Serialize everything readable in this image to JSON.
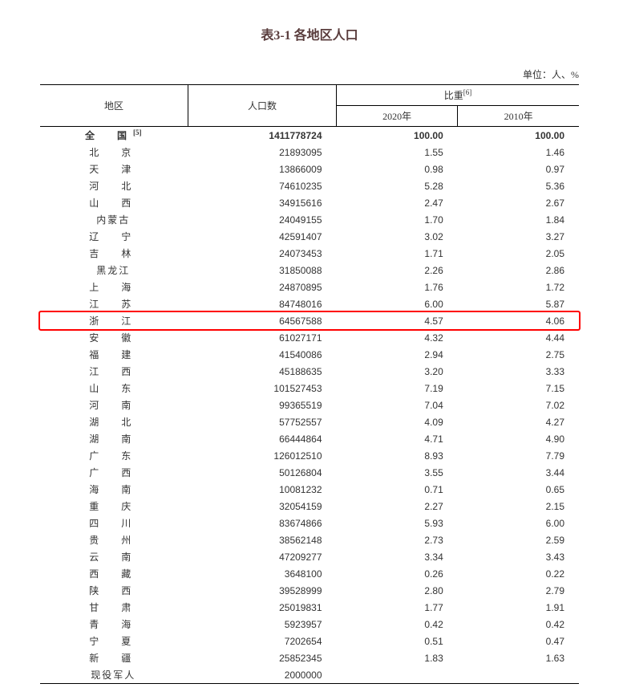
{
  "title": "表3-1 各地区人口",
  "unit": "单位：人、%",
  "headers": {
    "region": "地区",
    "population": "人口数",
    "ratio": "比重",
    "ratio_sup": "[6]",
    "year2020": "2020年",
    "year2010": "2010年"
  },
  "total_row": {
    "region": "全　国",
    "region_sup": "[5]",
    "population": "1411778724",
    "ratio2020": "100.00",
    "ratio2010": "100.00"
  },
  "rows": [
    {
      "region": "北　京",
      "population": "21893095",
      "r2020": "1.55",
      "r2010": "1.46",
      "tight": false
    },
    {
      "region": "天　津",
      "population": "13866009",
      "r2020": "0.98",
      "r2010": "0.97",
      "tight": false
    },
    {
      "region": "河　北",
      "population": "74610235",
      "r2020": "5.28",
      "r2010": "5.36",
      "tight": false
    },
    {
      "region": "山　西",
      "population": "34915616",
      "r2020": "2.47",
      "r2010": "2.67",
      "tight": false
    },
    {
      "region": "内蒙古",
      "population": "24049155",
      "r2020": "1.70",
      "r2010": "1.84",
      "tight": true
    },
    {
      "region": "辽　宁",
      "population": "42591407",
      "r2020": "3.02",
      "r2010": "3.27",
      "tight": false
    },
    {
      "region": "吉　林",
      "population": "24073453",
      "r2020": "1.71",
      "r2010": "2.05",
      "tight": false
    },
    {
      "region": "黑龙江",
      "population": "31850088",
      "r2020": "2.26",
      "r2010": "2.86",
      "tight": true
    },
    {
      "region": "上　海",
      "population": "24870895",
      "r2020": "1.76",
      "r2010": "1.72",
      "tight": false
    },
    {
      "region": "江　苏",
      "population": "84748016",
      "r2020": "6.00",
      "r2010": "5.87",
      "tight": false
    },
    {
      "region": "浙　江",
      "population": "64567588",
      "r2020": "4.57",
      "r2010": "4.06",
      "tight": false,
      "highlight": true
    },
    {
      "region": "安　徽",
      "population": "61027171",
      "r2020": "4.32",
      "r2010": "4.44",
      "tight": false
    },
    {
      "region": "福　建",
      "population": "41540086",
      "r2020": "2.94",
      "r2010": "2.75",
      "tight": false
    },
    {
      "region": "江　西",
      "population": "45188635",
      "r2020": "3.20",
      "r2010": "3.33",
      "tight": false
    },
    {
      "region": "山　东",
      "population": "101527453",
      "r2020": "7.19",
      "r2010": "7.15",
      "tight": false
    },
    {
      "region": "河　南",
      "population": "99365519",
      "r2020": "7.04",
      "r2010": "7.02",
      "tight": false
    },
    {
      "region": "湖　北",
      "population": "57752557",
      "r2020": "4.09",
      "r2010": "4.27",
      "tight": false
    },
    {
      "region": "湖　南",
      "population": "66444864",
      "r2020": "4.71",
      "r2010": "4.90",
      "tight": false
    },
    {
      "region": "广　东",
      "population": "126012510",
      "r2020": "8.93",
      "r2010": "7.79",
      "tight": false
    },
    {
      "region": "广　西",
      "population": "50126804",
      "r2020": "3.55",
      "r2010": "3.44",
      "tight": false
    },
    {
      "region": "海　南",
      "population": "10081232",
      "r2020": "0.71",
      "r2010": "0.65",
      "tight": false
    },
    {
      "region": "重　庆",
      "population": "32054159",
      "r2020": "2.27",
      "r2010": "2.15",
      "tight": false
    },
    {
      "region": "四　川",
      "population": "83674866",
      "r2020": "5.93",
      "r2010": "6.00",
      "tight": false
    },
    {
      "region": "贵　州",
      "population": "38562148",
      "r2020": "2.73",
      "r2010": "2.59",
      "tight": false
    },
    {
      "region": "云　南",
      "population": "47209277",
      "r2020": "3.34",
      "r2010": "3.43",
      "tight": false
    },
    {
      "region": "西　藏",
      "population": "3648100",
      "r2020": "0.26",
      "r2010": "0.22",
      "tight": false
    },
    {
      "region": "陕　西",
      "population": "39528999",
      "r2020": "2.80",
      "r2010": "2.79",
      "tight": false
    },
    {
      "region": "甘　肃",
      "population": "25019831",
      "r2020": "1.77",
      "r2010": "1.91",
      "tight": false
    },
    {
      "region": "青　海",
      "population": "5923957",
      "r2020": "0.42",
      "r2010": "0.42",
      "tight": false
    },
    {
      "region": "宁　夏",
      "population": "7202654",
      "r2020": "0.51",
      "r2010": "0.47",
      "tight": false
    },
    {
      "region": "新　疆",
      "population": "25852345",
      "r2020": "1.83",
      "r2010": "1.63",
      "tight": false
    },
    {
      "region": "现役军人",
      "population": "2000000",
      "r2020": "",
      "r2010": "",
      "tight": true
    }
  ]
}
